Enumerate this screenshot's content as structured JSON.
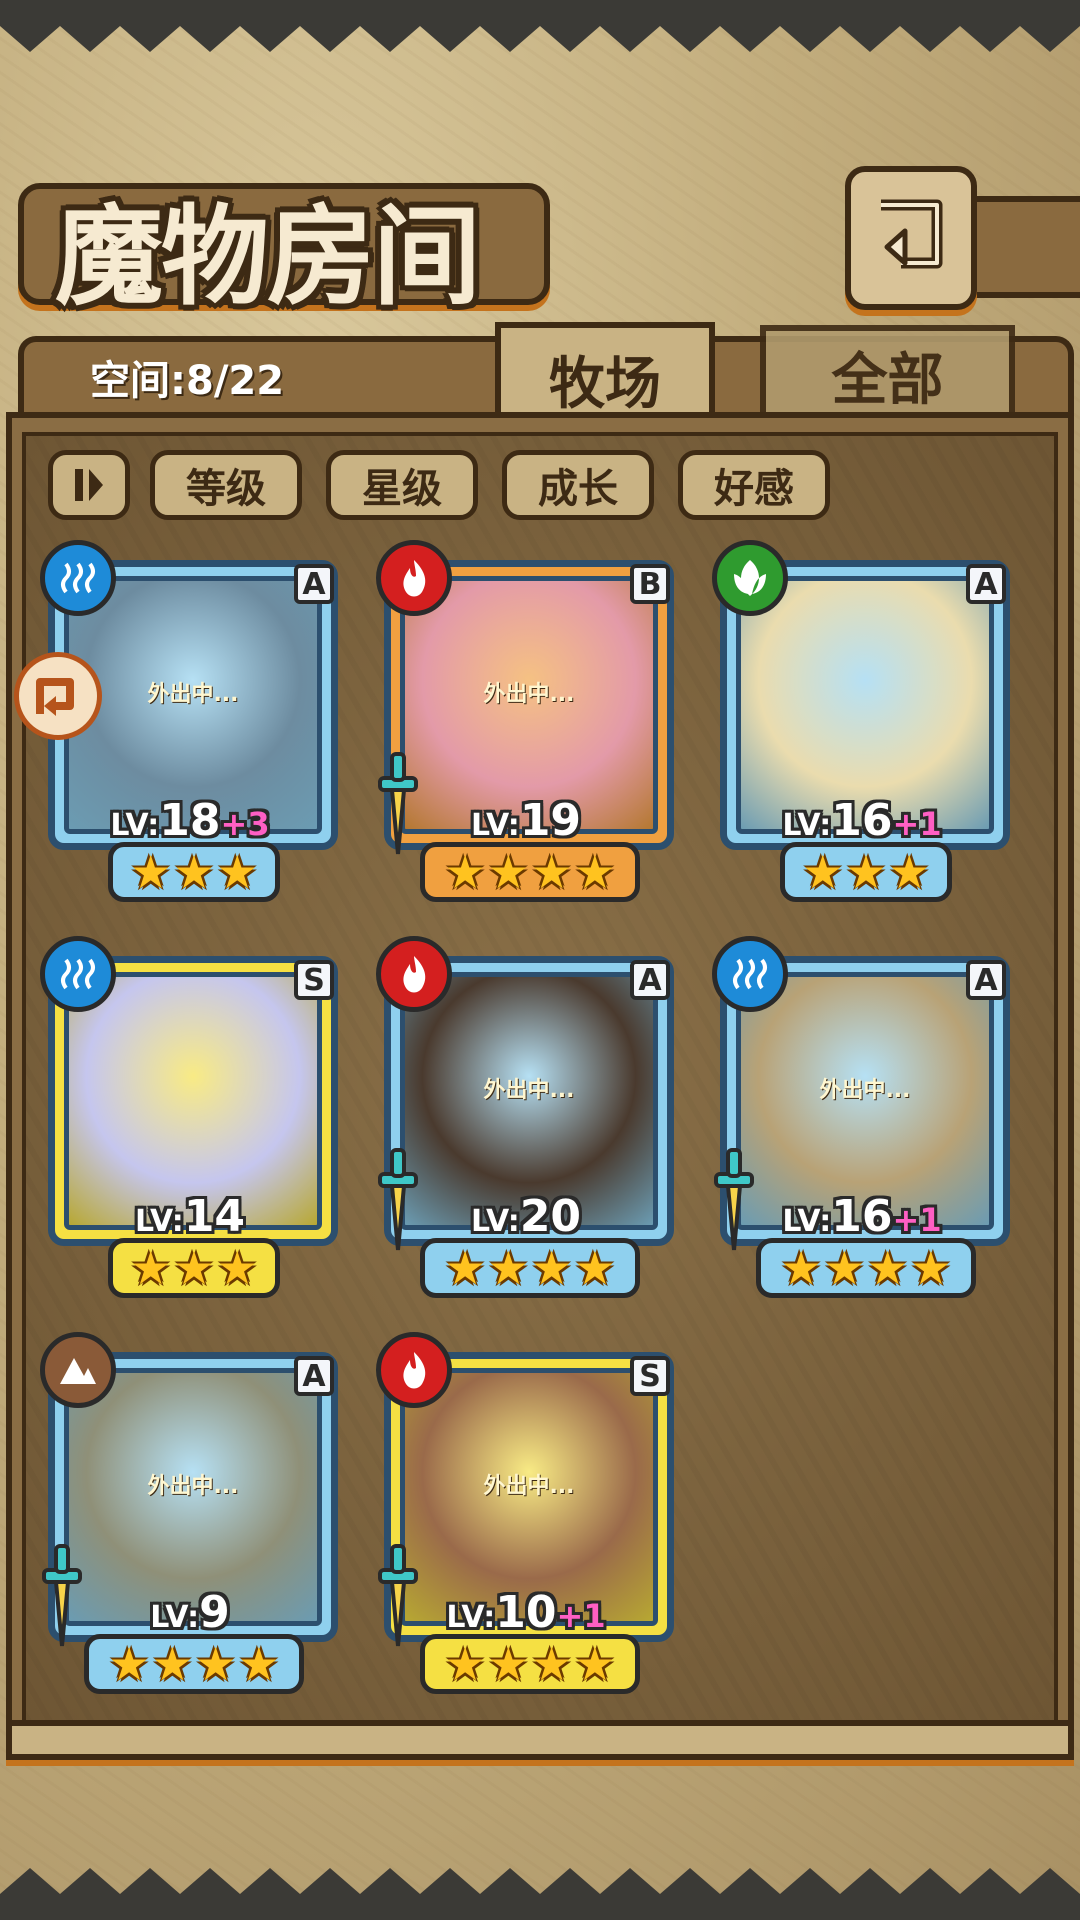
{
  "header": {
    "title": "魔物房间",
    "back_icon": "back-return-icon"
  },
  "tabs": {
    "space_label": "空间:8/22",
    "active": "牧场",
    "inactive": "全部"
  },
  "sort": {
    "toggle_icon": "sort-toggle-icon",
    "buttons": [
      "等级",
      "星级",
      "成长",
      "好感"
    ]
  },
  "colors": {
    "water": "#1e8bd8",
    "fire": "#d41f1f",
    "wood": "#2f9b2f",
    "earth": "#8a5a38",
    "frame_a": "#8fd0ee",
    "frame_b": "#f0a040",
    "frame_s": "#f5e043",
    "star": "#ffc31f",
    "level_bonus": "#ff5fc4"
  },
  "cards": [
    {
      "element": "water",
      "rank": "A",
      "frame": "a",
      "status": "外出中...",
      "level_prefix": "LV:",
      "level": "18",
      "bonus": "+3",
      "stars": 3,
      "sword": false,
      "portrait": "#6d8ca0"
    },
    {
      "element": "fire",
      "rank": "B",
      "frame": "b",
      "status": "外出中...",
      "level_prefix": "LV:",
      "level": "19",
      "bonus": "",
      "stars": 4,
      "sword": true,
      "portrait": "#e39aa8"
    },
    {
      "element": "wood",
      "rank": "A",
      "frame": "a",
      "status": "",
      "level_prefix": "LV:",
      "level": "16",
      "bonus": "+1",
      "stars": 3,
      "sword": false,
      "portrait": "#eadcae"
    },
    {
      "element": "water",
      "rank": "S",
      "frame": "s",
      "status": "",
      "level_prefix": "LV:",
      "level": "14",
      "bonus": "",
      "stars": 3,
      "sword": false,
      "portrait": "#c5c6ee"
    },
    {
      "element": "fire",
      "rank": "A",
      "frame": "a",
      "status": "外出中...",
      "level_prefix": "LV:",
      "level": "20",
      "bonus": "",
      "stars": 4,
      "sword": true,
      "portrait": "#4a3a2e"
    },
    {
      "element": "water",
      "rank": "A",
      "frame": "a",
      "status": "外出中...",
      "level_prefix": "LV:",
      "level": "16",
      "bonus": "+1",
      "stars": 4,
      "sword": true,
      "portrait": "#b8a276"
    },
    {
      "element": "earth",
      "rank": "A",
      "frame": "a",
      "status": "外出中...",
      "level_prefix": "LV:",
      "level": "9",
      "bonus": "",
      "stars": 4,
      "sword": true,
      "portrait": "#8f9078"
    },
    {
      "element": "fire",
      "rank": "S",
      "frame": "s",
      "status": "外出中...",
      "level_prefix": "LV:",
      "level": "10",
      "bonus": "+1",
      "stars": 4,
      "sword": true,
      "portrait": "#9a6a4a"
    }
  ],
  "side_button_icon": "paw-return-icon"
}
